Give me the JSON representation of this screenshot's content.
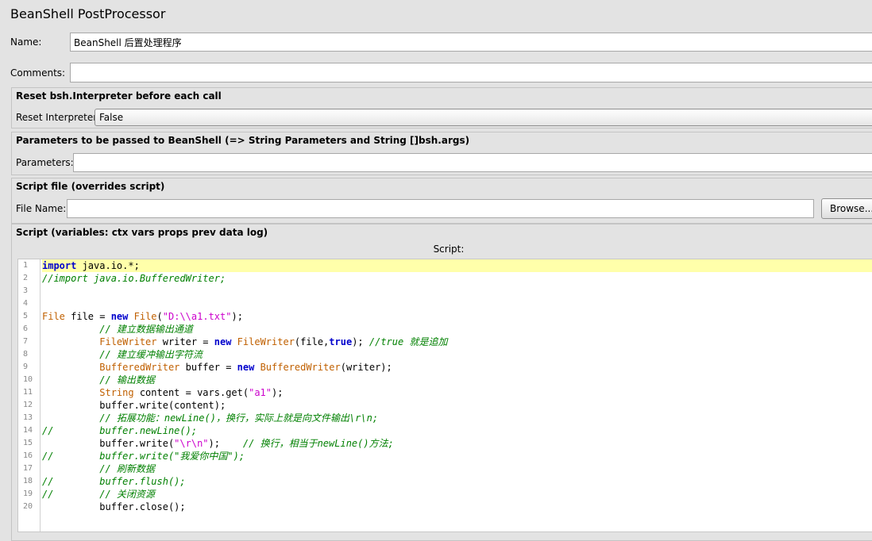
{
  "window": {
    "title": "BeanShell PostProcessor"
  },
  "name": {
    "label": "Name:",
    "value": "BeanShell 后置处理程序"
  },
  "comments": {
    "label": "Comments:",
    "value": ""
  },
  "reset": {
    "section": "Reset bsh.Interpreter before each call",
    "label": "Reset Interpreter:",
    "value": "False"
  },
  "parameters": {
    "section": "Parameters to be passed to BeanShell (=> String Parameters and String []bsh.args)",
    "label": "Parameters:",
    "value": ""
  },
  "file": {
    "section": "Script file (overrides script)",
    "label": "File Name:",
    "value": "",
    "browse": "Browse..."
  },
  "script": {
    "section": "Script (variables: ctx vars props prev data log)",
    "caption": "Script:",
    "line_numbers": [
      "1",
      "2",
      "3",
      "4",
      "5",
      "6",
      "7",
      "8",
      "9",
      "10",
      "11",
      "12",
      "13",
      "14",
      "15",
      "16",
      "17",
      "18",
      "19",
      "20"
    ],
    "lines": [
      "import java.io.*;",
      "//import java.io.BufferedWriter;",
      "",
      "",
      "File file = new File(\"D:\\\\a1.txt\");",
      "          // 建立数据输出通道",
      "          FileWriter writer = new FileWriter(file,true); //true 就是追加",
      "          // 建立缓冲输出字符流",
      "          BufferedWriter buffer = new BufferedWriter(writer);",
      "          // 输出数据",
      "          String content = vars.get(\"a1\");",
      "          buffer.write(content);",
      "          // 拓展功能：newLine()，换行，实际上就是向文件输出\\r\\n;",
      "//        buffer.newLine();",
      "          buffer.write(\"\\r\\n\");    // 换行，相当于newLine()方法;",
      "//        buffer.write(\"我爱你中国\");",
      "          // 刷新数据",
      "//        buffer.flush();",
      "//        // 关闭资源",
      "          buffer.close();"
    ]
  }
}
